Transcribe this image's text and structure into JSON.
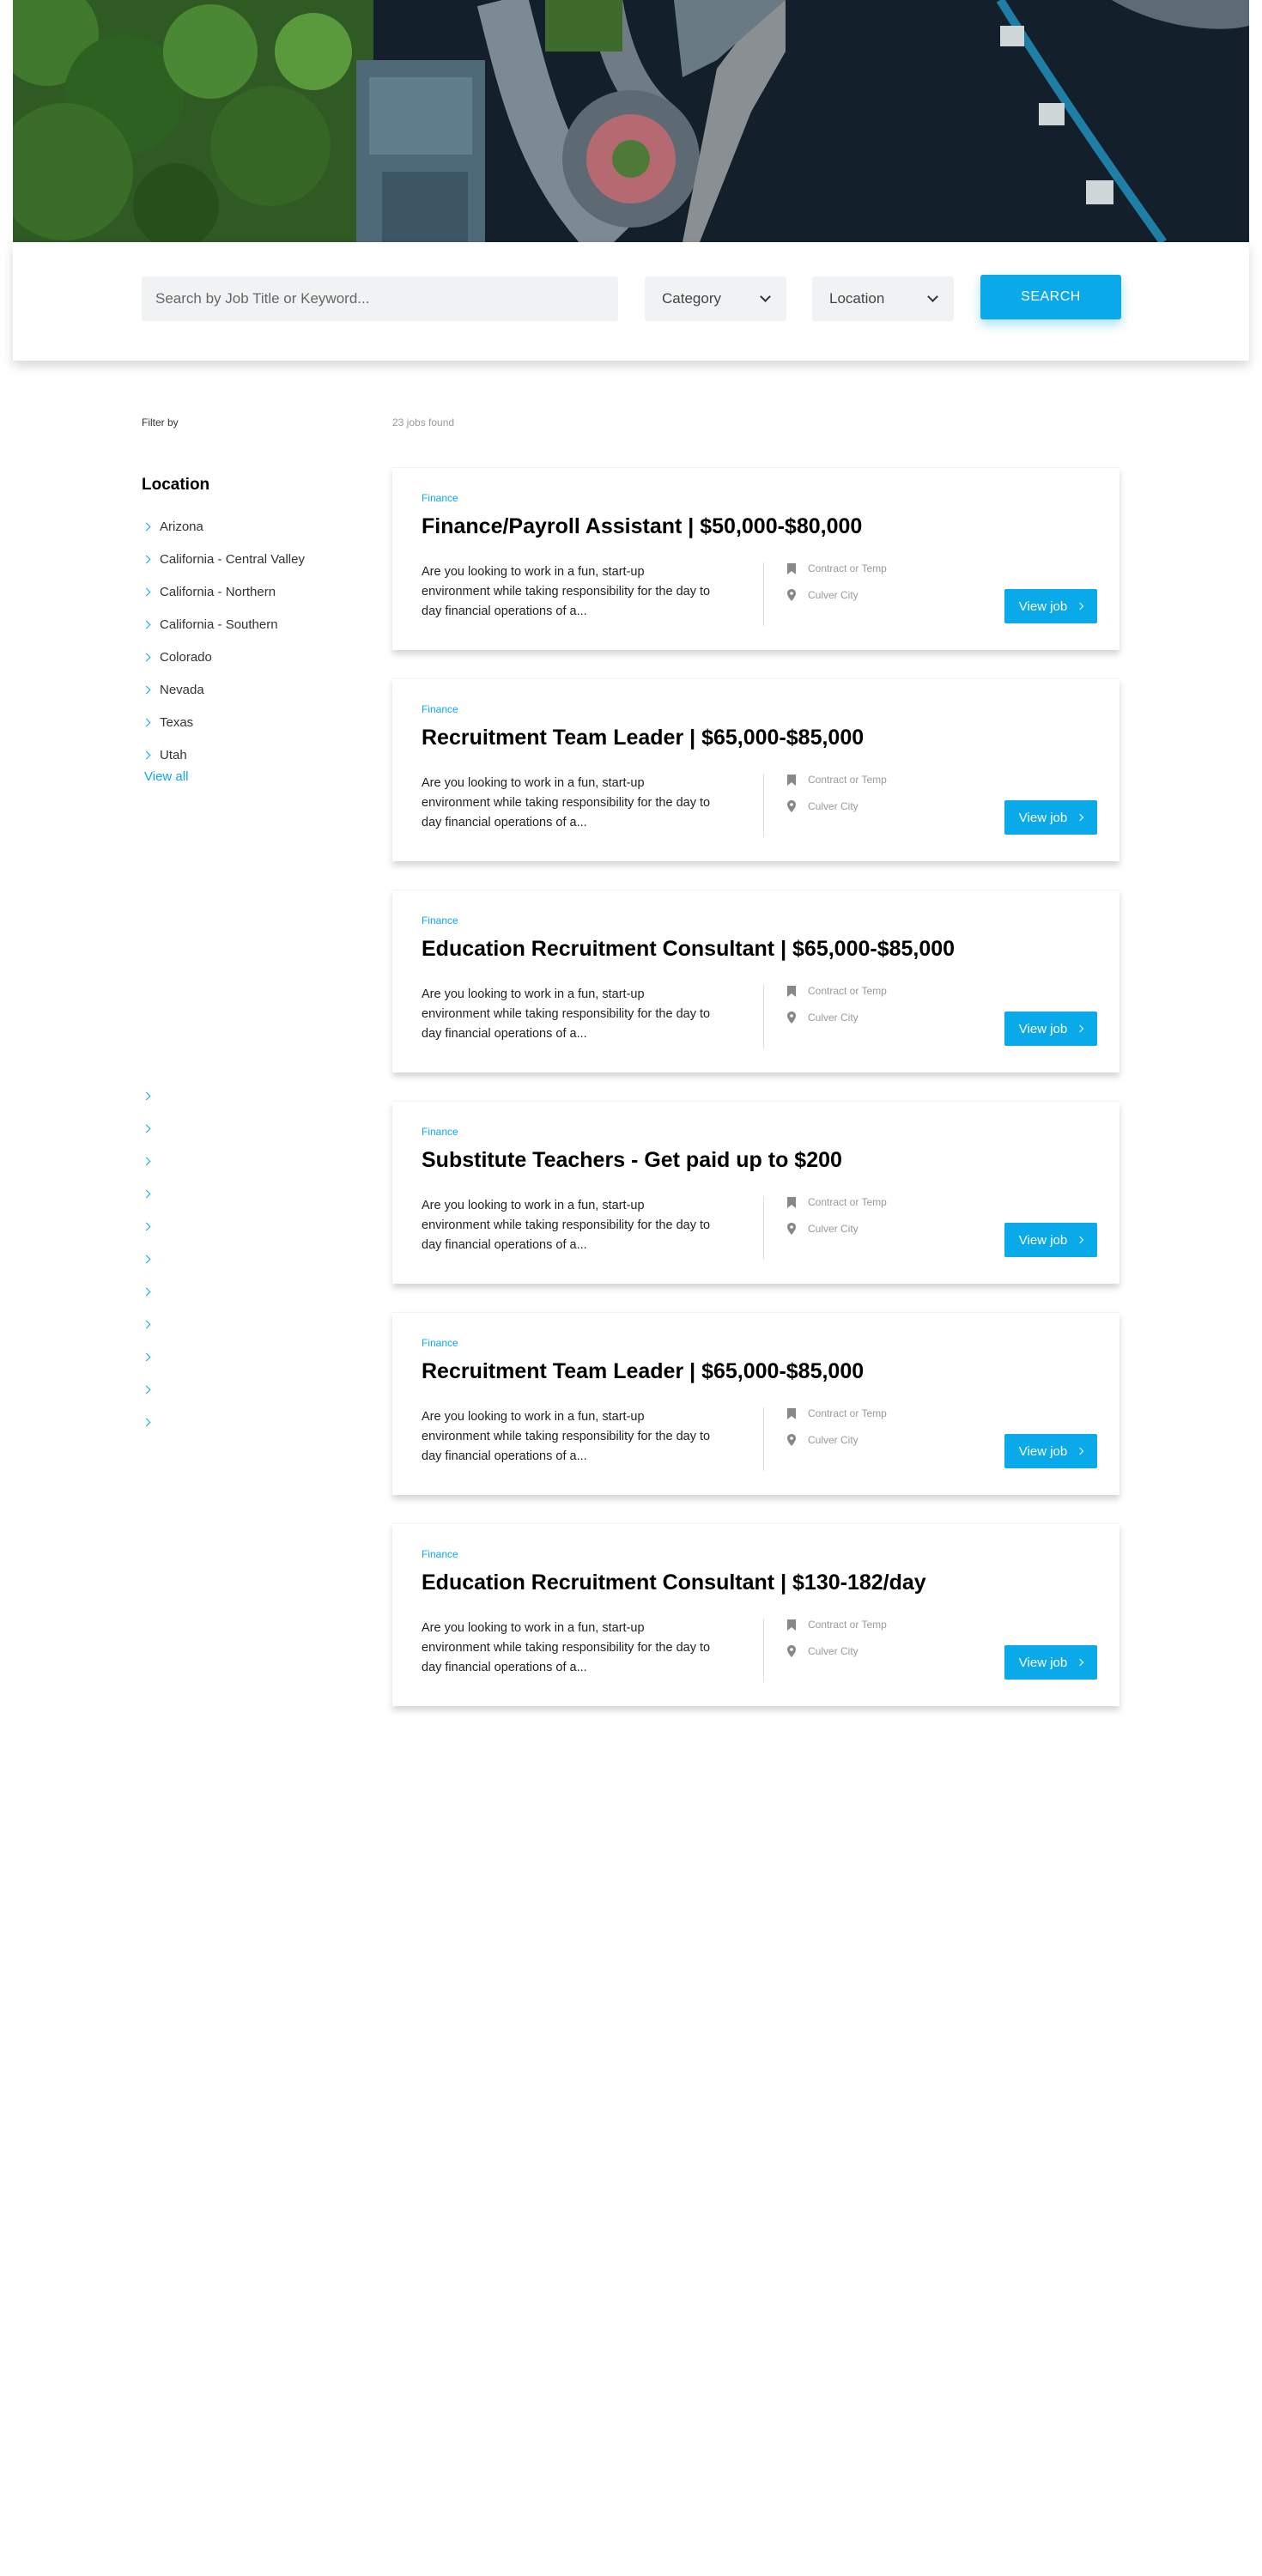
{
  "search": {
    "placeholder": "Search by Job Title or Keyword...",
    "category_label": "Category",
    "location_label": "Location",
    "button_label": "SEARCH"
  },
  "filters": {
    "filter_by_label": "Filter by",
    "jobs_found": "23 jobs found",
    "location_title": "Location",
    "locations": [
      "Arizona",
      "California - Central Valley",
      "California - Northern",
      "California - Southern",
      "Colorado",
      "Nevada",
      "Texas",
      "Utah"
    ],
    "view_all": "View all"
  },
  "jobs": [
    {
      "category": "Finance",
      "title": "Finance/Payroll Assistant | $50,000-$80,000",
      "description": "Are you looking to work in a fun, start-up environment while taking responsibility for the day to day financial operations of a...",
      "type": "Contract or Temp",
      "location": "Culver City",
      "button": "View job"
    },
    {
      "category": "Finance",
      "title": "Recruitment Team Leader | $65,000-$85,000",
      "description": "Are you looking to work in a fun, start-up environment while taking responsibility for the day to day financial operations of a...",
      "type": "Contract or Temp",
      "location": "Culver City",
      "button": "View job"
    },
    {
      "category": "Finance",
      "title": "Education Recruitment Consultant | $65,000-$85,000",
      "description": "Are you looking to work in a fun, start-up environment while taking responsibility for the day to day financial operations of a...",
      "type": "Contract or Temp",
      "location": "Culver City",
      "button": "View job"
    },
    {
      "category": "Finance",
      "title": "Substitute Teachers - Get paid up to $200",
      "description": "Are you looking to work in a fun, start-up environment while taking responsibility for the day to day financial operations of a...",
      "type": "Contract or Temp",
      "location": "Culver City",
      "button": "View job"
    },
    {
      "category": "Finance",
      "title": "Recruitment Team Leader | $65,000-$85,000",
      "description": "Are you looking to work in a fun, start-up environment while taking responsibility for the day to day financial operations of a...",
      "type": "Contract or Temp",
      "location": "Culver City",
      "button": "View job"
    },
    {
      "category": "Finance",
      "title": "Education Recruitment Consultant | $130-182/day",
      "description": "Are you looking to work in a fun, start-up environment while taking responsibility for the day to day financial operations of a...",
      "type": "Contract or Temp",
      "location": "Culver City",
      "button": "View job"
    }
  ],
  "colors": {
    "accent": "#0aa9e9",
    "field_bg": "#f1f2f3"
  }
}
